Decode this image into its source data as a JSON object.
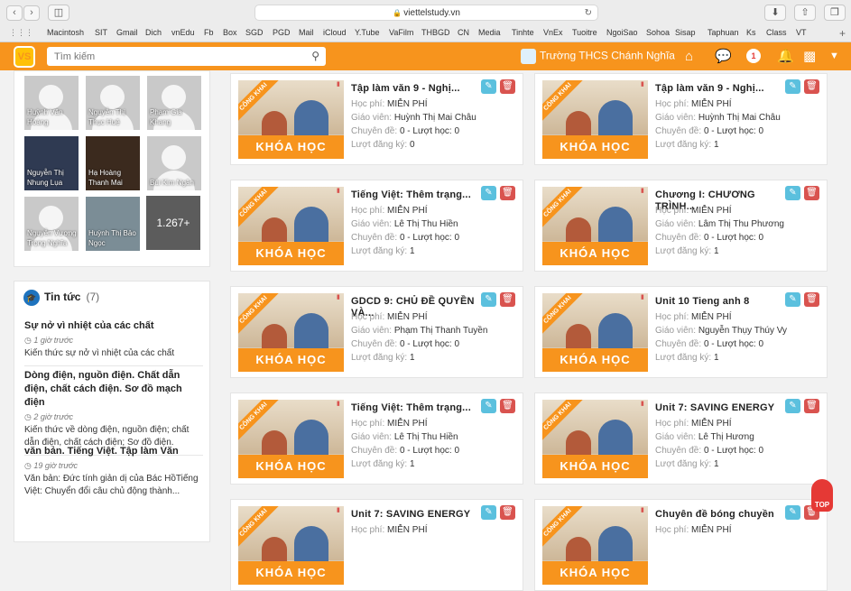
{
  "browser": {
    "url": "viettelstudy.vn",
    "bookmarks": [
      "Macintosh",
      "SIT",
      "Gmail",
      "Dich",
      "vnEdu",
      "Fb",
      "Box",
      "SGD",
      "PGD",
      "Mail",
      "iCloud",
      "Y.Tube",
      "VaFilm",
      "THBGD",
      "CN",
      "Media",
      "Tinhte",
      "VnEx",
      "Tuoitre",
      "NgoiSao",
      "Sohoa",
      "Sisap",
      "Taphuan",
      "Ks",
      "Class",
      "VT"
    ]
  },
  "header": {
    "logo_text": "VS",
    "search_placeholder": "Tìm kiếm",
    "school_name": "Trường THCS Chánh Nghĩa",
    "notification_count": "1",
    "accent": "#f7941d"
  },
  "members": [
    {
      "name": "Huỳnh Văn Hoàng",
      "avatar": "generic"
    },
    {
      "name": "Nguyễn Thị Thục Huệ",
      "avatar": "generic"
    },
    {
      "name": "Phạm Gia Khang",
      "avatar": "generic"
    },
    {
      "name": "Nguyễn Thị Nhung Lụa",
      "avatar": "photo"
    },
    {
      "name": "Hạ Hoàng Thanh Mai",
      "avatar": "photo"
    },
    {
      "name": "Bùi Kim Ngân",
      "avatar": "generic"
    },
    {
      "name": "Nguyễn Vương Trọng Nghĩa",
      "avatar": "generic"
    },
    {
      "name": "Huỳnh Thị Bảo Ngọc",
      "avatar": "photo"
    }
  ],
  "members_more": "1.267+",
  "news": {
    "title": "Tin tức",
    "count": "(7)",
    "items": [
      {
        "title": "Sự nở vì nhiệt của các chất",
        "time": "1 giờ trước",
        "desc": "Kiến thức sự nở vì nhiệt của các chất"
      },
      {
        "title": "Dòng điện, nguồn điện. Chất dẫn điện, chất cách điện. Sơ đồ mạch điện",
        "time": "2 giờ trước",
        "desc": "Kiến thức về dòng điện, nguồn điện; chất dẫn điện, chất cách điện; Sơ đồ điện."
      },
      {
        "title": "văn bản. Tiếng Việt. Tập làm Văn",
        "time": "19 giờ trước",
        "desc": "Văn bản: Đức tính giản dị của Bác HồTiếng Việt: Chuyển đổi câu chủ động thành..."
      }
    ]
  },
  "labels": {
    "fee": "Học phí:",
    "teacher": "Giáo viên:",
    "topics": "Chuyên đề:",
    "lessons": "- Lượt học:",
    "registrations": "Lượt đăng ký:",
    "thumb_band": "KHÓA HỌC",
    "thumb_ribbon": "CÔNG KHAI"
  },
  "courses": [
    {
      "title": "Tập làm văn 9 - Nghị...",
      "fee": "MIỄN PHÍ",
      "teacher": "Huỳnh Thị Mai Châu",
      "topics": "0",
      "lessons": "0",
      "registrations": "0"
    },
    {
      "title": "Tập làm văn 9 - Nghị...",
      "fee": "MIỄN PHÍ",
      "teacher": "Huỳnh Thị Mai Châu",
      "topics": "0",
      "lessons": "0",
      "registrations": "1"
    },
    {
      "title": "Tiếng Việt: Thêm trạng...",
      "fee": "MIỄN PHÍ",
      "teacher": "Lê Thị Thu Hiền",
      "topics": "0",
      "lessons": "0",
      "registrations": "1"
    },
    {
      "title": "Chương I: CHƯƠNG TRÌNH...",
      "fee": "MIỄN PHÍ",
      "teacher": "Lâm Thị Thu Phương",
      "topics": "0",
      "lessons": "0",
      "registrations": "1"
    },
    {
      "title": "GDCD 9: CHỦ ĐỀ QUYỀN VÀ...",
      "fee": "MIỄN PHÍ",
      "teacher": "Phạm Thị Thanh Tuyền",
      "topics": "0",
      "lessons": "0",
      "registrations": "1"
    },
    {
      "title": "Unit 10 Tieng anh 8",
      "fee": "MIỄN PHÍ",
      "teacher": "Nguyễn Thụy Thúy Vy",
      "topics": "0",
      "lessons": "0",
      "registrations": "1"
    },
    {
      "title": "Tiếng Việt: Thêm trạng...",
      "fee": "MIỄN PHÍ",
      "teacher": "Lê Thị Thu Hiền",
      "topics": "0",
      "lessons": "0",
      "registrations": "1"
    },
    {
      "title": "Unit 7: SAVING ENERGY",
      "fee": "MIỄN PHÍ",
      "teacher": "Lê Thị Hương",
      "topics": "0",
      "lessons": "0",
      "registrations": "1"
    },
    {
      "title": "Unit 7: SAVING ENERGY",
      "fee": "MIỄN PHÍ"
    },
    {
      "title": "Chuyên đề bóng chuyền",
      "fee": "MIỄN PHÍ"
    }
  ],
  "scroll_top_label": "TOP"
}
